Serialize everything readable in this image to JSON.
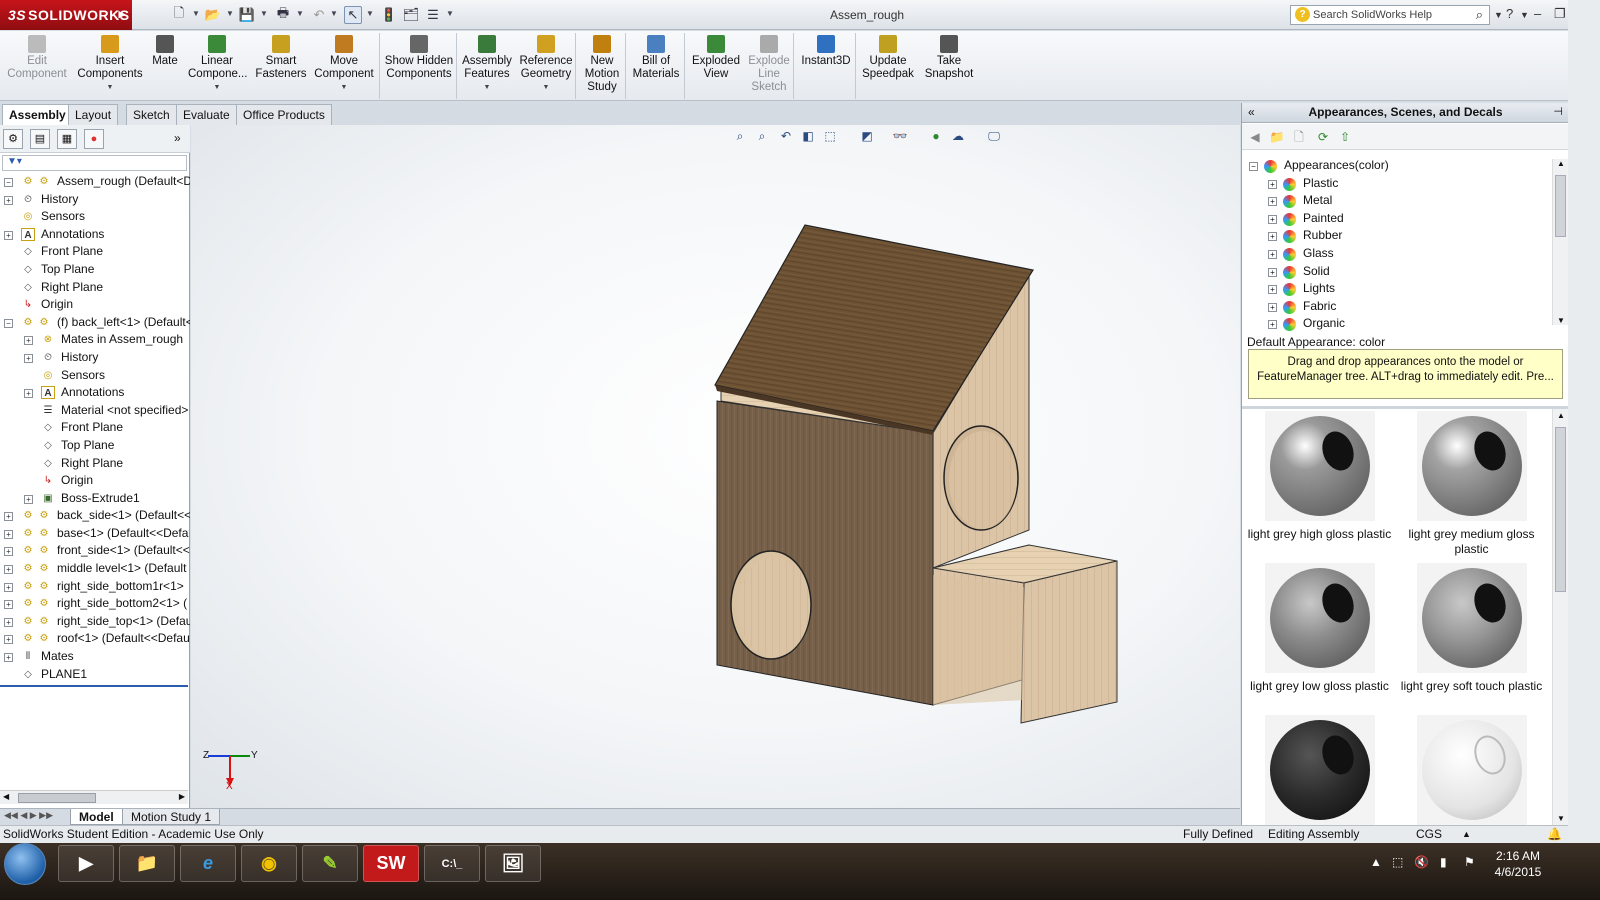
{
  "app": {
    "logo_text": "SOLIDWORKS",
    "logo_mark": "3S",
    "document_title": "Assem_rough",
    "search_placeholder": "Search SolidWorks Help"
  },
  "ribbon": [
    {
      "id": "edit-component",
      "label": "Edit Component",
      "icon": "edit-component-icon",
      "disabled": true
    },
    {
      "id": "insert-components",
      "label": "Insert Components",
      "icon": "insert-components-icon",
      "dropdown": true
    },
    {
      "id": "mate",
      "label": "Mate",
      "icon": "paperclip-icon"
    },
    {
      "id": "linear-component-pattern",
      "label": "Linear Compone...",
      "icon": "linear-pattern-icon",
      "dropdown": true
    },
    {
      "id": "smart-fasteners",
      "label": "Smart Fasteners",
      "icon": "smart-fasteners-icon"
    },
    {
      "id": "move-component",
      "label": "Move Component",
      "icon": "move-component-icon",
      "dropdown": true
    },
    {
      "id": "show-hidden-components",
      "label": "Show Hidden Components",
      "icon": "show-hidden-icon"
    },
    {
      "id": "assembly-features",
      "label": "Assembly Features",
      "icon": "assembly-features-icon",
      "dropdown": true
    },
    {
      "id": "reference-geometry",
      "label": "Reference Geometry",
      "icon": "reference-geometry-icon",
      "dropdown": true
    },
    {
      "id": "new-motion-study",
      "label": "New Motion Study",
      "icon": "motion-study-icon"
    },
    {
      "id": "bill-of-materials",
      "label": "Bill of Materials",
      "icon": "bom-icon"
    },
    {
      "id": "exploded-view",
      "label": "Exploded View",
      "icon": "exploded-view-icon"
    },
    {
      "id": "explode-line-sketch",
      "label": "Explode Line Sketch",
      "icon": "explode-line-icon",
      "disabled": true
    },
    {
      "id": "instant3d",
      "label": "Instant3D",
      "icon": "instant3d-icon"
    },
    {
      "id": "update-speedpak",
      "label": "Update Speedpak",
      "icon": "speedpak-icon"
    },
    {
      "id": "take-snapshot",
      "label": "Take Snapshot",
      "icon": "camera-icon"
    }
  ],
  "command_tabs": [
    "Assembly",
    "Layout",
    "Sketch",
    "Evaluate",
    "Office Products"
  ],
  "feature_tree": [
    {
      "level": 0,
      "exp": "minus",
      "icon": "assembly-icon",
      "label": "Assem_rough  (Default<Disp"
    },
    {
      "level": 0,
      "exp": "plus",
      "icon": "history-icon",
      "label": "History"
    },
    {
      "level": 0,
      "exp": "",
      "icon": "sensors-icon",
      "label": "Sensors"
    },
    {
      "level": 0,
      "exp": "plus",
      "icon": "annotations-icon",
      "label": "Annotations"
    },
    {
      "level": 0,
      "exp": "",
      "icon": "plane-icon",
      "label": "Front Plane"
    },
    {
      "level": 0,
      "exp": "",
      "icon": "plane-icon",
      "label": "Top Plane"
    },
    {
      "level": 0,
      "exp": "",
      "icon": "plane-icon",
      "label": "Right Plane"
    },
    {
      "level": 0,
      "exp": "",
      "icon": "origin-icon",
      "label": "Origin"
    },
    {
      "level": 0,
      "exp": "minus",
      "icon": "part-icon",
      "label": "(f) back_left<1> (Default<"
    },
    {
      "level": 1,
      "exp": "plus",
      "icon": "mates-icon",
      "label": "Mates in Assem_rough"
    },
    {
      "level": 1,
      "exp": "plus",
      "icon": "history-icon",
      "label": "History"
    },
    {
      "level": 1,
      "exp": "",
      "icon": "sensors-icon",
      "label": "Sensors"
    },
    {
      "level": 1,
      "exp": "plus",
      "icon": "annotations-icon",
      "label": "Annotations"
    },
    {
      "level": 1,
      "exp": "",
      "icon": "material-icon",
      "label": "Material <not specified>"
    },
    {
      "level": 1,
      "exp": "",
      "icon": "plane-icon",
      "label": "Front Plane"
    },
    {
      "level": 1,
      "exp": "",
      "icon": "plane-icon",
      "label": "Top Plane"
    },
    {
      "level": 1,
      "exp": "",
      "icon": "plane-icon",
      "label": "Right Plane"
    },
    {
      "level": 1,
      "exp": "",
      "icon": "origin-icon",
      "label": "Origin"
    },
    {
      "level": 1,
      "exp": "plus",
      "icon": "extrude-icon",
      "label": "Boss-Extrude1"
    },
    {
      "level": 0,
      "exp": "plus",
      "icon": "part-icon",
      "label": "back_side<1> (Default<<"
    },
    {
      "level": 0,
      "exp": "plus",
      "icon": "part-icon",
      "label": "base<1> (Default<<Defa"
    },
    {
      "level": 0,
      "exp": "plus",
      "icon": "part-icon",
      "label": "front_side<1> (Default<<"
    },
    {
      "level": 0,
      "exp": "plus",
      "icon": "part-icon",
      "label": "middle level<1> (Default"
    },
    {
      "level": 0,
      "exp": "plus",
      "icon": "part-icon",
      "label": "right_side_bottom1r<1>"
    },
    {
      "level": 0,
      "exp": "plus",
      "icon": "part-icon",
      "label": "right_side_bottom2<1> ("
    },
    {
      "level": 0,
      "exp": "plus",
      "icon": "part-icon",
      "label": "right_side_top<1> (Defau"
    },
    {
      "level": 0,
      "exp": "plus",
      "icon": "part-icon",
      "label": "roof<1> (Default<<Defau"
    },
    {
      "level": 0,
      "exp": "plus",
      "icon": "mates-folder-icon",
      "label": "Mates"
    },
    {
      "level": 0,
      "exp": "",
      "icon": "plane-icon",
      "label": "PLANE1"
    }
  ],
  "bottom_tabs": [
    "Model",
    "Motion Study 1"
  ],
  "task_pane": {
    "title": "Appearances, Scenes, and Decals",
    "tree": [
      {
        "level": 0,
        "exp": "minus",
        "label": "Appearances(color)"
      },
      {
        "level": 1,
        "exp": "plus",
        "label": "Plastic"
      },
      {
        "level": 1,
        "exp": "plus",
        "label": "Metal"
      },
      {
        "level": 1,
        "exp": "plus",
        "label": "Painted"
      },
      {
        "level": 1,
        "exp": "plus",
        "label": "Rubber"
      },
      {
        "level": 1,
        "exp": "plus",
        "label": "Glass"
      },
      {
        "level": 1,
        "exp": "plus",
        "label": "Solid"
      },
      {
        "level": 1,
        "exp": "plus",
        "label": "Lights"
      },
      {
        "level": 1,
        "exp": "plus",
        "label": "Fabric"
      },
      {
        "level": 1,
        "exp": "plus",
        "label": "Organic"
      }
    ],
    "default_appearance": "Default Appearance: color",
    "tip": "Drag and drop appearances onto the model or FeatureManager tree.  ALT+drag to immediately edit.  Pre...",
    "swatches": [
      {
        "label": "light grey high gloss plastic",
        "color": "#9a9a9a",
        "style": "gloss"
      },
      {
        "label": "light grey medium gloss plastic",
        "color": "#a3a3a3",
        "style": "gloss"
      },
      {
        "label": "light grey low gloss plastic",
        "color": "#8d8d8d",
        "style": "matte"
      },
      {
        "label": "light grey soft touch plastic",
        "color": "#999999",
        "style": "matte"
      },
      {
        "label": "",
        "color": "#2a2a2a",
        "style": "textured"
      },
      {
        "label": "",
        "color": "#e4e4e4",
        "style": "clear"
      }
    ]
  },
  "statusbar": {
    "left": "SolidWorks Student Edition - Academic Use Only",
    "state": "Fully Defined",
    "mode": "Editing Assembly",
    "units": "CGS"
  },
  "taskbar": {
    "time": "2:16 AM",
    "date": "4/6/2015"
  },
  "triad": {
    "z": "Z",
    "y": "Y",
    "x": "X"
  }
}
